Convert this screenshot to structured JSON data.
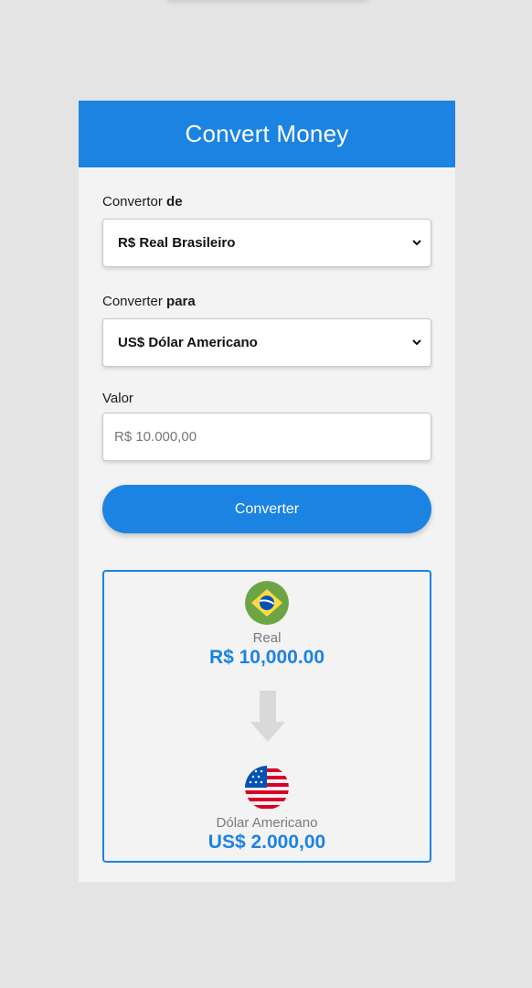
{
  "header": {
    "title": "Convert Money"
  },
  "form": {
    "from": {
      "label_prefix": "Convertor ",
      "label_bold": "de",
      "selected": "R$ Real Brasileiro"
    },
    "to": {
      "label_prefix": "Converter ",
      "label_bold": "para",
      "selected": "US$ Dólar Americano"
    },
    "amount": {
      "label": "Valor",
      "placeholder": "R$ 10.000,00"
    },
    "submit_label": "Converter"
  },
  "result": {
    "source": {
      "currency_name": "Real",
      "value": "R$ 10,000.00",
      "flag_icon": "brazil-flag-icon"
    },
    "target": {
      "currency_name": "Dólar Americano",
      "value": "US$ 2.000,00",
      "flag_icon": "usa-flag-icon"
    },
    "arrow_icon": "arrow-down-icon"
  },
  "colors": {
    "accent": "#1b83e1",
    "card_bg": "#f3f3f3",
    "page_bg": "#e4e4e4",
    "arrow": "#d9d9d9"
  }
}
